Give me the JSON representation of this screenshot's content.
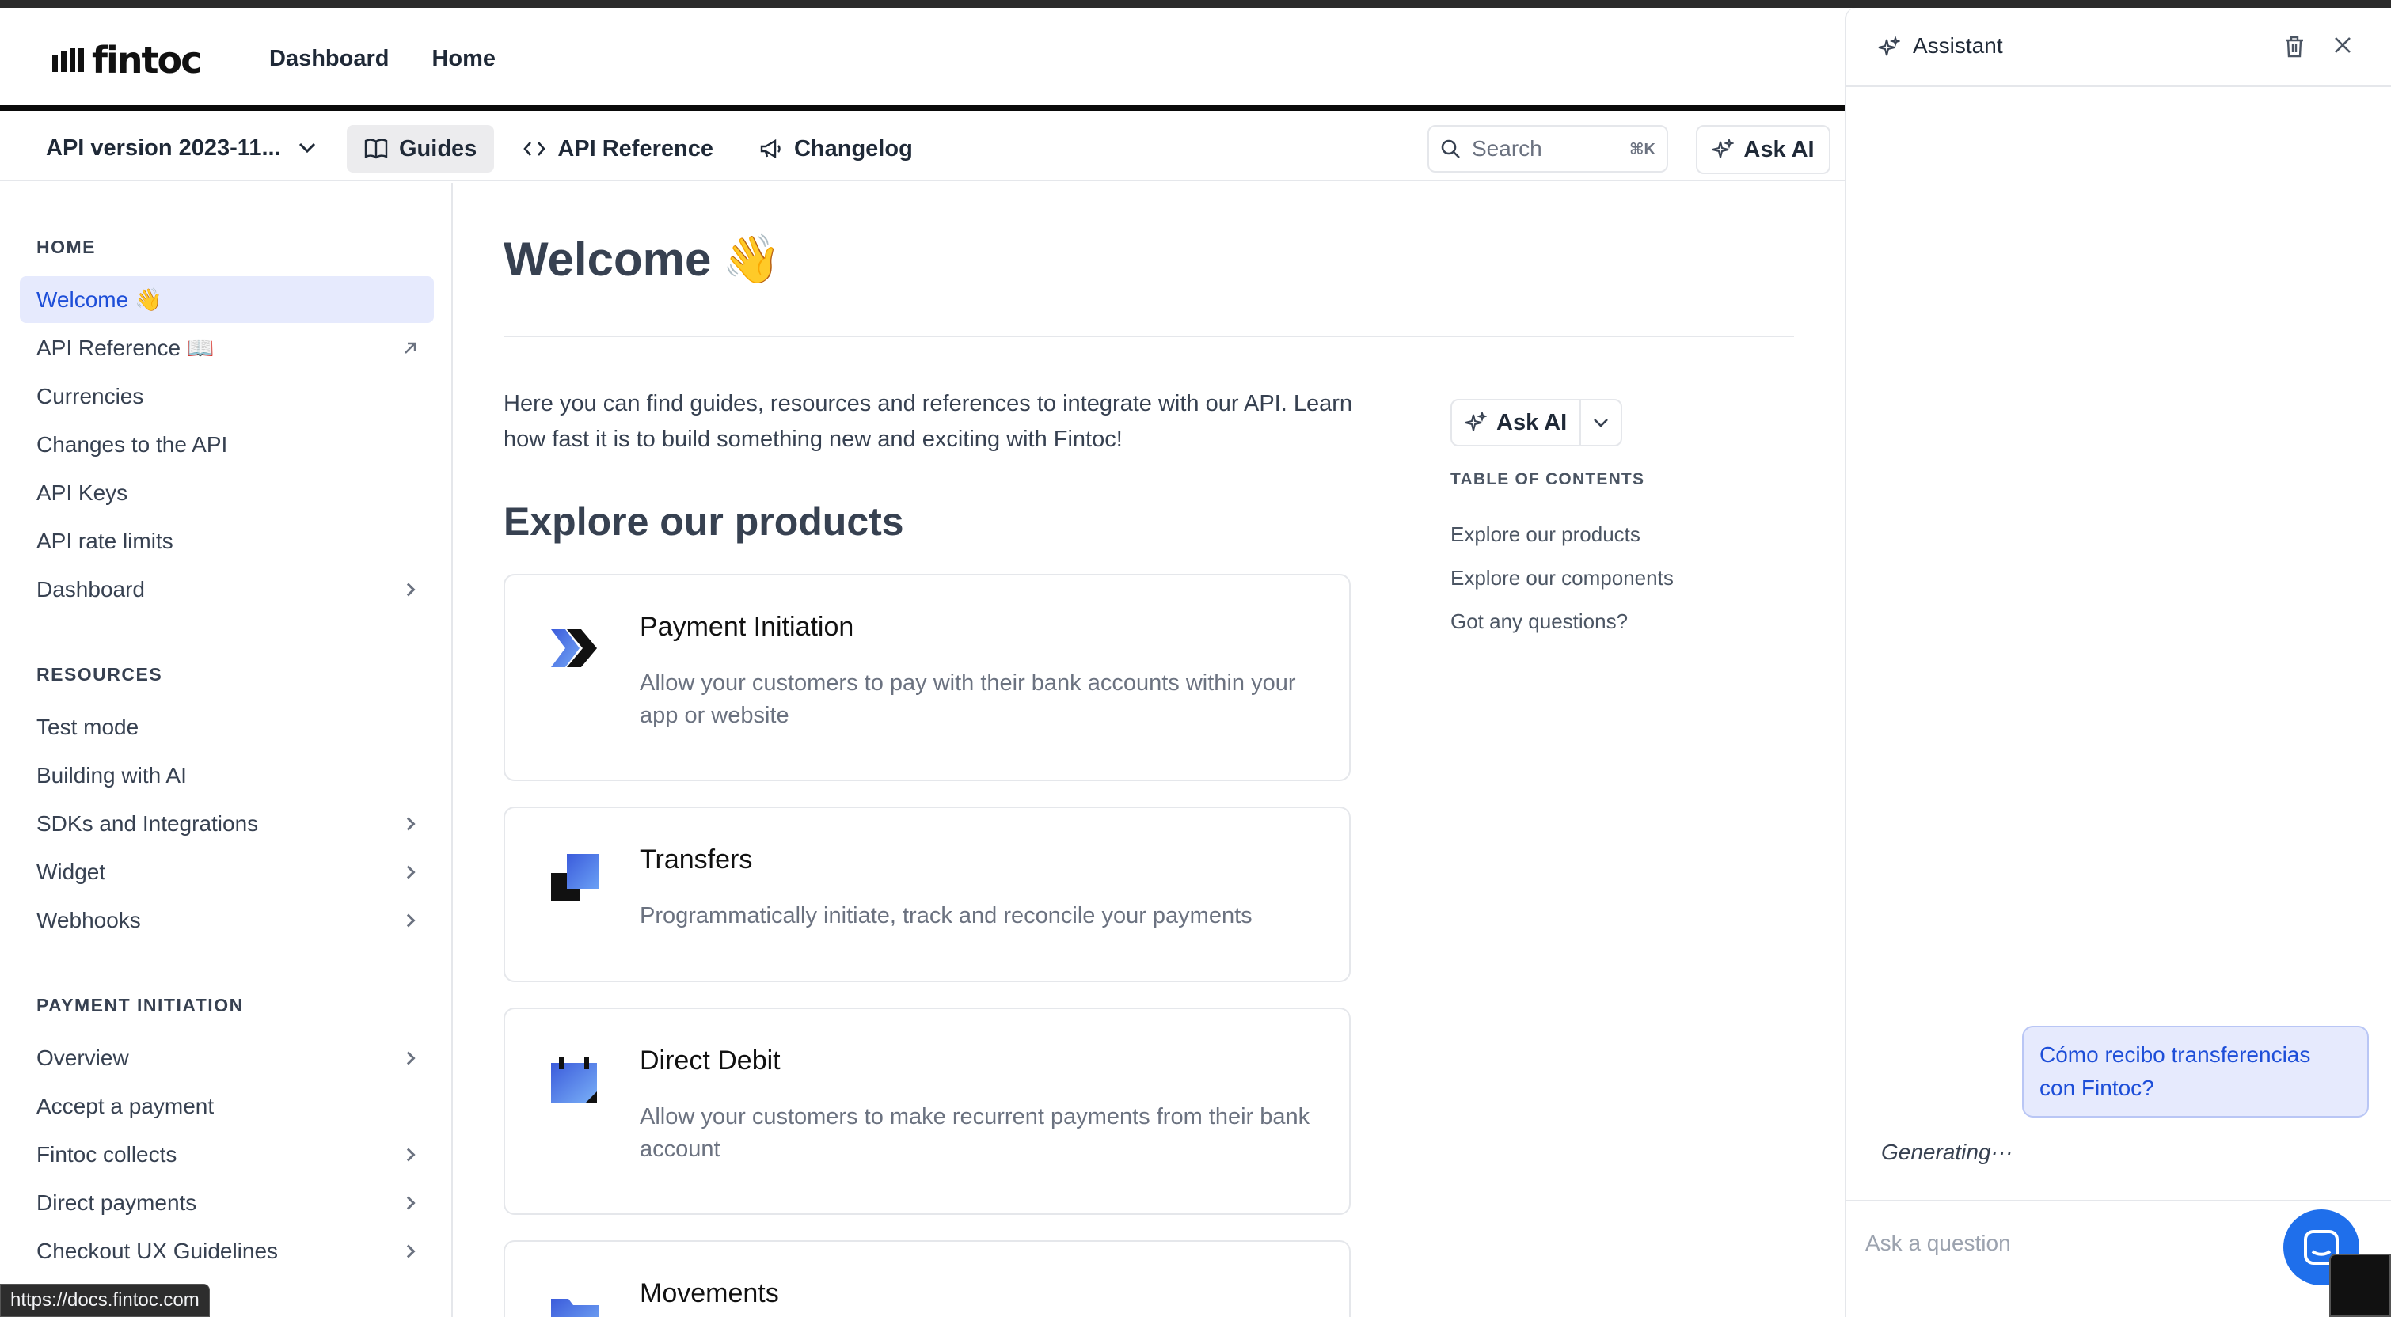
{
  "header": {
    "logo_text": "fintoc",
    "nav": [
      "Dashboard",
      "Home"
    ]
  },
  "subheader": {
    "version_label": "API version 2023-11...",
    "tabs": [
      {
        "label": "Guides",
        "icon": "book-icon",
        "active": true
      },
      {
        "label": "API Reference",
        "icon": "code-icon",
        "active": false
      },
      {
        "label": "Changelog",
        "icon": "megaphone-icon",
        "active": false
      }
    ],
    "search_placeholder": "Search",
    "search_shortcut": "⌘K",
    "ask_ai": "Ask AI"
  },
  "sidebar": {
    "sections": [
      {
        "title": "HOME",
        "items": [
          {
            "label": "Welcome 👋",
            "active": true,
            "trail": "none"
          },
          {
            "label": "API Reference 📖",
            "trail": "external"
          },
          {
            "label": "Currencies",
            "trail": "none"
          },
          {
            "label": "Changes to the API",
            "trail": "none"
          },
          {
            "label": "API Keys",
            "trail": "none"
          },
          {
            "label": "API rate limits",
            "trail": "none"
          },
          {
            "label": "Dashboard",
            "trail": "chevron"
          }
        ]
      },
      {
        "title": "RESOURCES",
        "items": [
          {
            "label": "Test mode",
            "trail": "none"
          },
          {
            "label": "Building with AI",
            "trail": "none"
          },
          {
            "label": "SDKs and Integrations",
            "trail": "chevron"
          },
          {
            "label": "Widget",
            "trail": "chevron"
          },
          {
            "label": "Webhooks",
            "trail": "chevron"
          }
        ]
      },
      {
        "title": "PAYMENT INITIATION",
        "items": [
          {
            "label": "Overview",
            "trail": "chevron"
          },
          {
            "label": "Accept a payment",
            "trail": "none"
          },
          {
            "label": "Fintoc collects",
            "trail": "chevron"
          },
          {
            "label": "Direct payments",
            "trail": "chevron"
          },
          {
            "label": "Checkout UX Guidelines",
            "trail": "chevron"
          }
        ]
      }
    ]
  },
  "main": {
    "title": "Welcome",
    "title_emoji": "👋",
    "intro": "Here you can find guides, resources and references to integrate with our API. Learn how fast it is to build something new and exciting with Fintoc!",
    "products_heading": "Explore our products",
    "cards": [
      {
        "title": "Payment Initiation",
        "desc": "Allow your customers to pay with their bank accounts within your app or website",
        "icon": "payment-initiation-icon"
      },
      {
        "title": "Transfers",
        "desc": "Programmatically initiate, track and reconcile your payments",
        "icon": "transfers-icon"
      },
      {
        "title": "Direct Debit",
        "desc": "Allow your customers to make recurrent payments from their bank account",
        "icon": "direct-debit-icon"
      },
      {
        "title": "Movements",
        "desc": "",
        "icon": "movements-icon"
      }
    ]
  },
  "toc": {
    "ask_ai": "Ask AI",
    "heading": "TABLE OF CONTENTS",
    "items": [
      "Explore our products",
      "Explore our components",
      "Got any questions?"
    ]
  },
  "assistant": {
    "title": "Assistant",
    "user_message": "Cómo recibo transferencias con Fintoc?",
    "status": "Generating···",
    "input_placeholder": "Ask a question"
  },
  "status_bar": {
    "url": "https://docs.fintoc.com"
  },
  "colors": {
    "accent": "#1d4ed8",
    "active_bg": "#e6eafd",
    "fab": "#1f6feb"
  }
}
